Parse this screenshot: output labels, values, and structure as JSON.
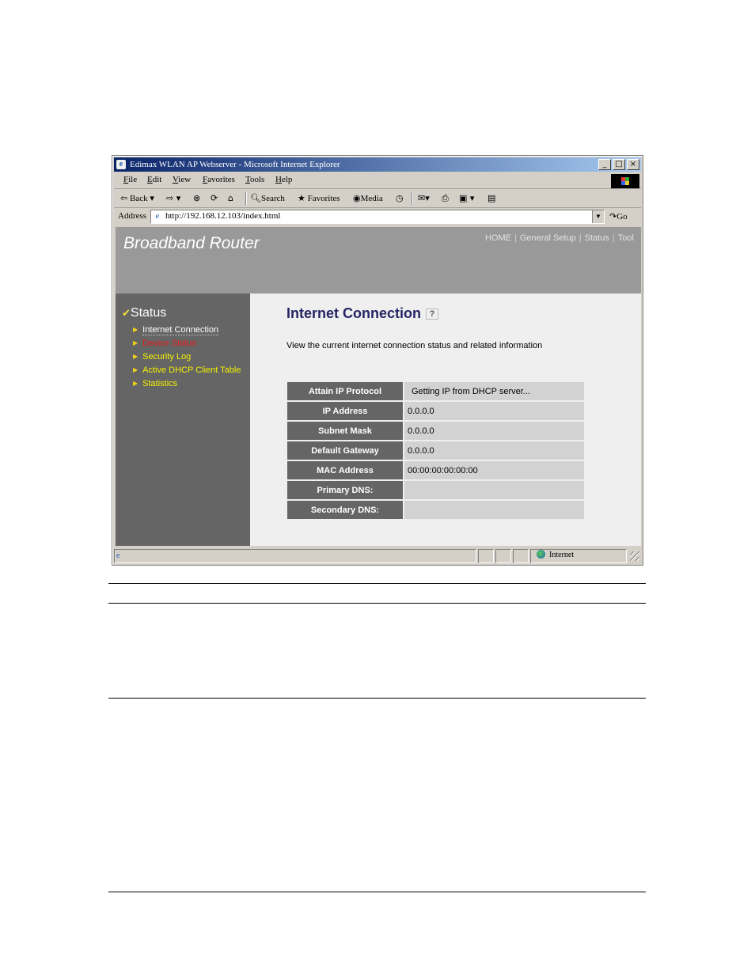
{
  "window": {
    "title": "Edimax WLAN AP Webserver - Microsoft Internet Explorer",
    "controls": [
      "_",
      "□",
      "×"
    ]
  },
  "menu": {
    "items": [
      {
        "key": "F",
        "rest": "ile"
      },
      {
        "key": "E",
        "rest": "dit"
      },
      {
        "key": "V",
        "rest": "iew"
      },
      {
        "key": "F",
        "rest": "avorites",
        "prefix": ""
      },
      {
        "key": "T",
        "rest": "ools"
      },
      {
        "key": "H",
        "rest": "elp"
      }
    ]
  },
  "toolbar": {
    "back": "Back",
    "search": "Search",
    "favorites": "Favorites",
    "media": "Media"
  },
  "address": {
    "label": "Address",
    "url": "http://192.168.12.103/index.html",
    "go": "Go"
  },
  "page": {
    "brand": "Broadband Router",
    "topnav": [
      "HOME",
      "General Setup",
      "Status",
      "Tool"
    ],
    "sidebar": {
      "title": "Status",
      "items": [
        {
          "label": "Internet Connection"
        },
        {
          "label": "Device Status"
        },
        {
          "label": "Security Log"
        },
        {
          "label": "Active DHCP Client Table"
        },
        {
          "label": "Statistics"
        }
      ]
    },
    "title": "Internet Connection",
    "description": "View the current internet connection status and related information",
    "info_rows": [
      {
        "label": "Attain IP Protocol",
        "value": "Getting IP from DHCP server..."
      },
      {
        "label": "IP Address",
        "value": "0.0.0.0"
      },
      {
        "label": "Subnet Mask",
        "value": "0.0.0.0"
      },
      {
        "label": "Default Gateway",
        "value": "0.0.0.0"
      },
      {
        "label": "MAC Address",
        "value": "00:00:00:00:00:00"
      },
      {
        "label": "Primary DNS:",
        "value": ""
      },
      {
        "label": "Secondary DNS:",
        "value": ""
      }
    ]
  },
  "statusbar": {
    "zone": "Internet"
  },
  "colors": {
    "header_bg": "#999999",
    "sidebar_bg": "#656565",
    "content_bg": "#efefef",
    "title_color": "#252564",
    "table_label_bg": "#656565",
    "table_value_bg": "#d2d2d2",
    "link_yellow": "#f3f000",
    "link_red": "#e41d1d"
  }
}
